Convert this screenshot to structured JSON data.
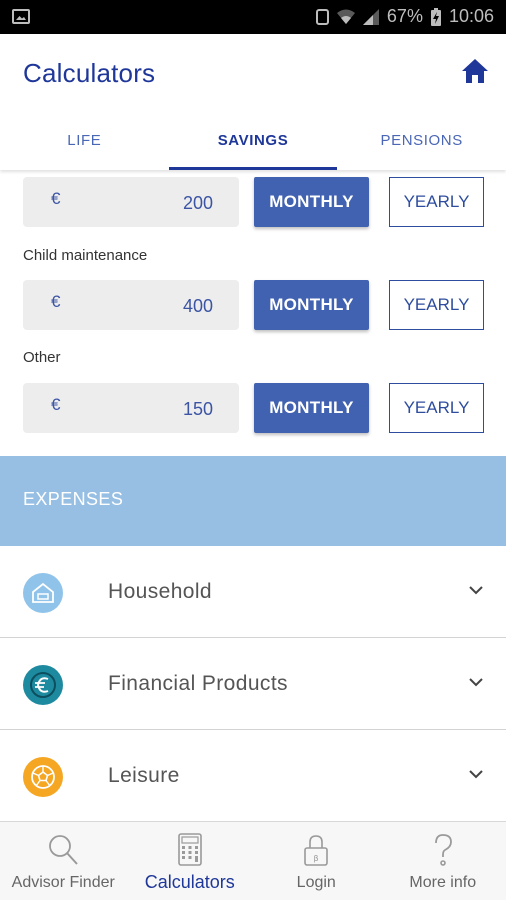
{
  "status_bar": {
    "battery": "67%",
    "time": "10:06"
  },
  "app": {
    "title": "Calculators",
    "home_icon": "home-icon"
  },
  "tabs": [
    {
      "label": "LIFE",
      "active": false
    },
    {
      "label": "SAVINGS",
      "active": true
    },
    {
      "label": "PENSIONS",
      "active": false
    }
  ],
  "income_rows": [
    {
      "label": "",
      "currency": "€",
      "value": "200",
      "monthly_label": "MONTHLY",
      "yearly_label": "YEARLY"
    },
    {
      "label": "Child maintenance",
      "currency": "€",
      "value": "400",
      "monthly_label": "MONTHLY",
      "yearly_label": "YEARLY"
    },
    {
      "label": "Other",
      "currency": "€",
      "value": "150",
      "monthly_label": "MONTHLY",
      "yearly_label": "YEARLY"
    }
  ],
  "expenses": {
    "title": "EXPENSES",
    "categories": [
      {
        "label": "Household",
        "icon": "house-icon",
        "color": "#8fc3ea"
      },
      {
        "label": "Financial Products",
        "icon": "euro-icon",
        "color": "#1e8aa0"
      },
      {
        "label": "Leisure",
        "icon": "ball-icon",
        "color": "#f5a623"
      }
    ]
  },
  "bottom_nav": [
    {
      "label": "Advisor Finder",
      "icon": "search-icon",
      "active": false
    },
    {
      "label": "Calculators",
      "icon": "calculator-icon",
      "active": true
    },
    {
      "label": "Login",
      "icon": "lock-icon",
      "active": false
    },
    {
      "label": "More info",
      "icon": "question-icon",
      "active": false
    }
  ],
  "colors": {
    "primary": "#1e3799",
    "button": "#4161b1",
    "expenses_header": "#97bfe3"
  }
}
